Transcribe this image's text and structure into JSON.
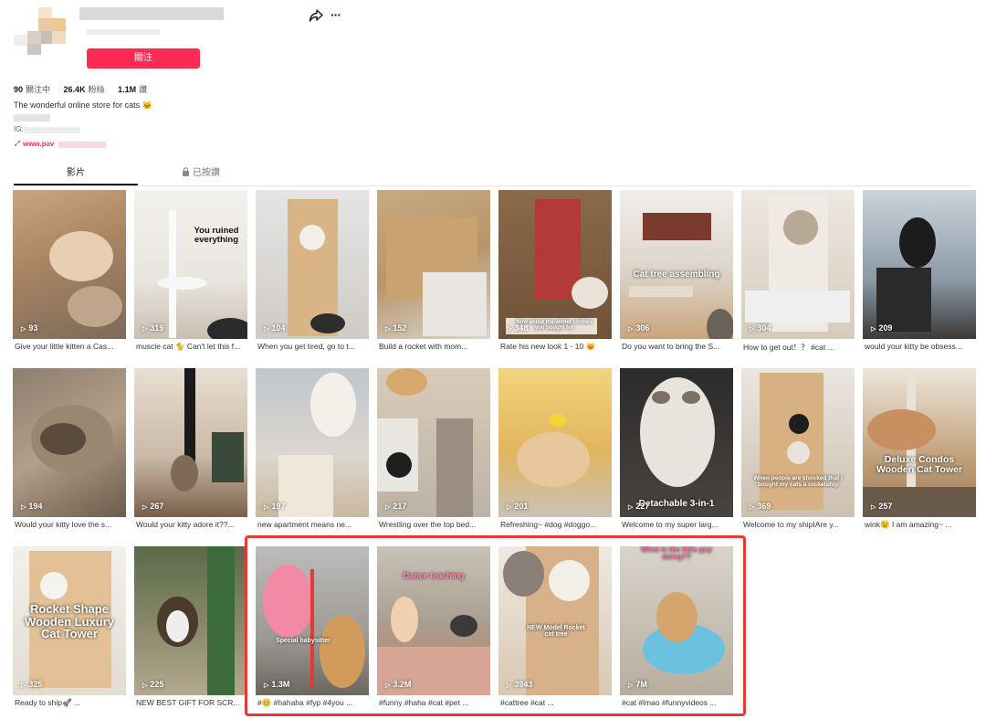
{
  "profile": {
    "follow_label": "關注",
    "share_icon": "share-arrow-icon",
    "more_icon": "more-horizontal-icon",
    "more_glyph": "···",
    "stats": [
      {
        "value": "90",
        "label": "關注中"
      },
      {
        "value": "26.4K",
        "label": "粉絲"
      },
      {
        "value": "1.1M",
        "label": "讚"
      }
    ],
    "bio": "The wonderful online store for cats 🐱",
    "ig_prefix": "IG:",
    "link": "www.pav"
  },
  "tabs": [
    {
      "label": "影片",
      "active": true
    },
    {
      "label": "已按讚",
      "icon": "lock-icon",
      "active": false
    }
  ],
  "colors": {
    "accent": "#fe2c55",
    "highlight": "#e53935"
  },
  "videos": [
    {
      "views": "93",
      "caption": "Give your little kitten a Cas..."
    },
    {
      "views": "319",
      "caption": "muscle cat 🐈 Can't let this f...",
      "overlay": "You ruined everything"
    },
    {
      "views": "104",
      "caption": "When you get tired, go to t..."
    },
    {
      "views": "152",
      "caption": "Build a rocket with mom..."
    },
    {
      "views": "348",
      "caption": "Rate his new look 1 - 10 🐱",
      "overlay": "Now about the winter clothes you bought for"
    },
    {
      "views": "306",
      "caption": "Do you want to bring the S...",
      "overlay": "Cat tree assembling"
    },
    {
      "views": "304",
      "caption": "How to get out！？ #cat ..."
    },
    {
      "views": "209",
      "caption": "would your kitty be obsess..."
    },
    {
      "views": "194",
      "caption": "Would your kitty love the s..."
    },
    {
      "views": "267",
      "caption": "Would your kitty adore it??..."
    },
    {
      "views": "197",
      "caption": "new apartment means ne..."
    },
    {
      "views": "217",
      "caption": "Wrestling over the top bed..."
    },
    {
      "views": "201",
      "caption": "Refreshing~ #dog #doggo..."
    },
    {
      "views": "227",
      "caption": "Welcome to my super larg...",
      "overlay": "Detachable 3-in-1"
    },
    {
      "views": "369",
      "caption": "Welcome to my shipIAre y...",
      "overlay": "When people are shocked that I bought my cats a rocketship"
    },
    {
      "views": "257",
      "caption": "wink😉 I am amazing~ ...",
      "overlay": "Deluxe Condos Wooden Cat Tower"
    },
    {
      "views": "325",
      "caption": "Ready to ship🚀 ...",
      "overlay": "Rocket Shape Wooden Luxury Cat Tower"
    },
    {
      "views": "225",
      "caption": "NEW BEST GIFT FOR SCR..."
    },
    {
      "views": "1.3M",
      "caption": "#😊 #hahaha #fyp #4you ...",
      "overlay": "Special babysitter"
    },
    {
      "views": "3.2M",
      "caption": "#funny #haha #cat #pet ...",
      "overlay": "Dance teaching"
    },
    {
      "views": "3943",
      "caption": "#cattree #cat ...",
      "overlay": "NEW Model Rocket cat tree"
    },
    {
      "views": "7M",
      "caption": "#cat #lmao #funnyvideos ...",
      "overlay": "What is the little guy doing??"
    }
  ]
}
